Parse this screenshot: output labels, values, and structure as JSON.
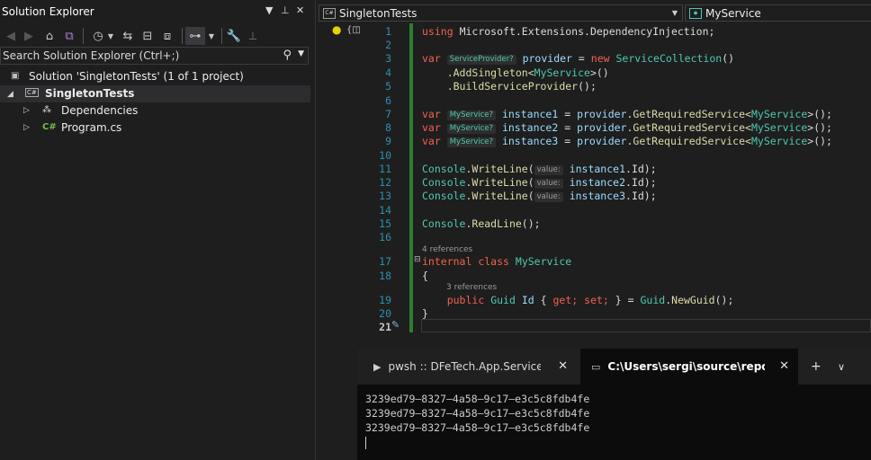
{
  "solution_explorer": {
    "title": "Solution Explorer",
    "search_placeholder": "Search Solution Explorer (Ctrl+;)",
    "tree": {
      "solution": "Solution 'SingletonTests' (1 of 1 project)",
      "project": "SingletonTests",
      "dependencies": "Dependencies",
      "program": "Program.cs",
      "cs_badge": "C#"
    }
  },
  "editor": {
    "file_dropdown": "SingletonTests",
    "member_dropdown": "MyService",
    "line_numbers": [
      "1",
      "2",
      "3",
      "4",
      "5",
      "6",
      "7",
      "8",
      "9",
      "10",
      "11",
      "12",
      "13",
      "14",
      "15",
      "16",
      "17",
      "18",
      "19",
      "20",
      "21"
    ],
    "tokens": {
      "using": "using",
      "ns": "Microsoft.Extensions.DependencyInjection;",
      "var": "var",
      "hint_sp": "ServiceProvider?",
      "provider": "provider",
      "eq": "=",
      "new": "new",
      "service_collection": "ServiceCollection",
      "parens": "()",
      "add_singleton": ".AddSingleton<",
      "my_service": "MyService",
      "gt_parens": ">()",
      "build": ".BuildServiceProvider",
      "end_call": "();",
      "hint_ms": "MyService?",
      "instance1": "instance1",
      "instance2": "instance2",
      "instance3": "instance3",
      "get_required": "GetRequiredService<",
      "gt_call_end": ">();",
      "dot": ".",
      "console": "Console",
      "write_line": "WriteLine",
      "open_paren": "(",
      "hint_value": "value:",
      "id_close": "Id);",
      "read_line": "ReadLine",
      "refs4": "4 references",
      "internal": "internal",
      "class": "class",
      "open_brace": "{",
      "refs3": "3 references",
      "public": "public",
      "guid": "Guid",
      "id": "Id",
      "get": "get;",
      "set": "set;",
      "guid_new": "NewGuid",
      "lbrace": "{",
      "rbrace_eq": "} =",
      "close_brace": "}"
    }
  },
  "terminal": {
    "tab1": "pwsh :: DFeTech.App.ServiceIn",
    "tab2": "C:\\Users\\sergi\\source\\repos\\F",
    "output": [
      "3239ed79–8327–4a58–9c17–e3c5c8fdb4fe",
      "3239ed79–8327–4a58–9c17–e3c5c8fdb4fe",
      "3239ed79–8327–4a58–9c17–e3c5c8fdb4fe"
    ]
  }
}
